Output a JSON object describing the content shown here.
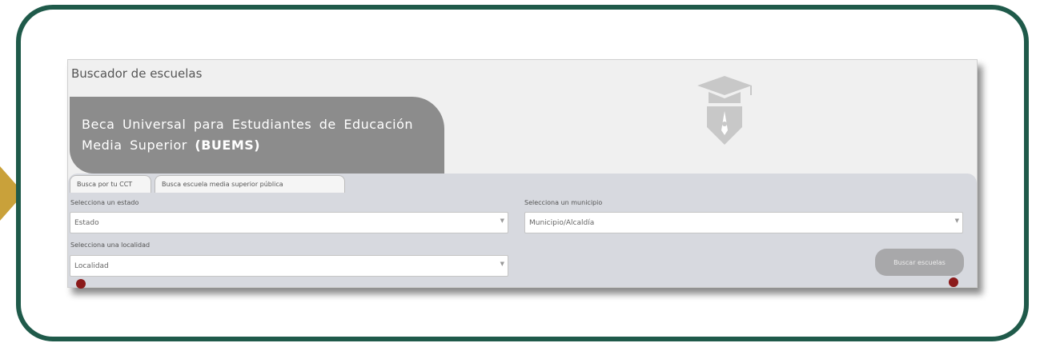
{
  "window": {
    "title": "Buscador de escuelas"
  },
  "banner": {
    "line_regular": "Beca Universal para Estudiantes de Educación Media Superior",
    "line_bold": "(BUEMS)"
  },
  "logo": {
    "icon": "graduation-cap-pen-icon"
  },
  "tabs": [
    {
      "label": "Busca por tu CCT"
    },
    {
      "label": "Busca escuela media superior pública"
    }
  ],
  "form": {
    "estado": {
      "label": "Selecciona un estado",
      "value": "Estado"
    },
    "municipio": {
      "label": "Selecciona un municipio",
      "value": "Municipio/Alcaldía"
    },
    "localidad": {
      "label": "Selecciona una localidad",
      "value": "Localidad"
    }
  },
  "search_button": {
    "label": "Buscar escuelas"
  },
  "colors": {
    "frame": "#1f5a4a",
    "arrow": "#c9a13a",
    "banner": "#8c8c8c",
    "panel": "#d7d9df",
    "button": "#a8a8aa",
    "marker": "#8b1a1a"
  }
}
